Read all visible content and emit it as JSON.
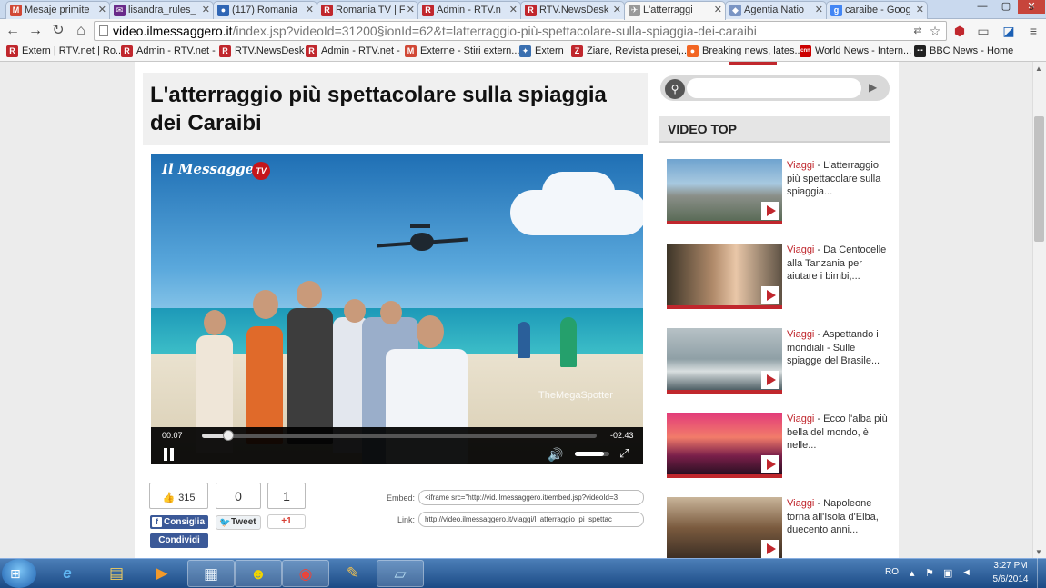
{
  "browser": {
    "tabs": [
      {
        "label": "Mesaje primite",
        "icon": "M",
        "color": "#d14836"
      },
      {
        "label": "lisandra_rules_",
        "icon": "✉",
        "color": "#6a2a8a"
      },
      {
        "label": "(117) Romania",
        "icon": "●",
        "color": "#2f66b5"
      },
      {
        "label": "Romania TV | F",
        "icon": "R",
        "color": "#c0272d"
      },
      {
        "label": "Admin - RTV.n",
        "icon": "R",
        "color": "#c0272d"
      },
      {
        "label": "RTV.NewsDesk",
        "icon": "R",
        "color": "#c0272d"
      },
      {
        "label": "L'atterraggi",
        "icon": "✈",
        "color": "#999999"
      },
      {
        "label": "Agentia Natio",
        "icon": "◆",
        "color": "#7a95c4"
      },
      {
        "label": "caraibe - Goog",
        "icon": "g",
        "color": "#4285f4"
      }
    ],
    "window_controls": [
      "—",
      "▢",
      "✕"
    ],
    "url_host": "video.ilmessaggero.it",
    "url_path": "/index.jsp?videoId=31200§ionId=62&t=latterraggio-più-spettacolare-sulla-spiaggia-dei-caraibi",
    "bookmarks": [
      {
        "label": "Extern | RTV.net | Ro...",
        "icon": "R",
        "color": "#c0272d"
      },
      {
        "label": "Admin - RTV.net -",
        "icon": "R",
        "color": "#c0272d"
      },
      {
        "label": "RTV.NewsDesk",
        "icon": "R",
        "color": "#c0272d"
      },
      {
        "label": "Admin - RTV.net -",
        "icon": "R",
        "color": "#c0272d"
      },
      {
        "label": "Externe - Stiri extern...",
        "icon": "M",
        "color": "#d14836"
      },
      {
        "label": "Extern",
        "icon": "✦",
        "color": "#3a6fb0"
      },
      {
        "label": "Ziare, Revista presei,...",
        "icon": "Z",
        "color": "#c0272d"
      },
      {
        "label": "Breaking news, lates...",
        "icon": "●",
        "color": "#f26522"
      },
      {
        "label": "World News - Intern...",
        "icon": "cnn",
        "color": "#cc0000"
      },
      {
        "label": "BBC News - Home",
        "icon": "▪▪▪",
        "color": "#222222"
      }
    ],
    "more_bookmarks": "»"
  },
  "article": {
    "title": "L'atterraggio più spettacolare sulla spiaggia dei Caraibi"
  },
  "video": {
    "brand": "Il Messaggero",
    "brand_badge": "TV",
    "watermark": "TheMegaSpotter",
    "time_current": "00:07",
    "time_remaining": "-02:43",
    "progress": 0.04,
    "volume": 0.85
  },
  "social": {
    "likes": "315",
    "tweets": "0",
    "plusones": "1",
    "fb_label": "Consiglia",
    "tw_label": "Tweet",
    "gp_label": "+1",
    "share_label": "Condividi",
    "embed_label": "Embed:",
    "embed_value": "<iframe src=\"http://vid.ilmessaggero.it/embed.jsp?videoId=3",
    "link_label": "Link:",
    "link_value": "http://video.ilmessaggero.it/viaggi/l_atterraggio_pi_spettac"
  },
  "sidebar": {
    "search_placeholder": "",
    "video_top_title": "VIDEO TOP",
    "items": [
      {
        "category": "Viaggi",
        "text": " - L'atterraggio più spettacolare sulla spiaggia..."
      },
      {
        "category": "Viaggi",
        "text": " - Da Centocelle alla Tanzania per aiutare i bimbi,..."
      },
      {
        "category": "Viaggi",
        "text": " - Aspettando i mondiali - Sulle spiagge del Brasile..."
      },
      {
        "category": "Viaggi",
        "text": " - Ecco l'alba più bella del mondo, è nelle..."
      },
      {
        "category": "Viaggi",
        "text": " - Napoleone torna all'Isola d'Elba, duecento anni..."
      }
    ]
  },
  "taskbar": {
    "apps": [
      "ie-icon",
      "explorer-icon",
      "media-player-icon",
      "documents-icon",
      "yahoo-messenger-icon",
      "chrome-icon",
      "paint-icon",
      "notepad-icon"
    ],
    "language": "RO",
    "time": "3:27 PM",
    "date": "5/6/2014"
  }
}
